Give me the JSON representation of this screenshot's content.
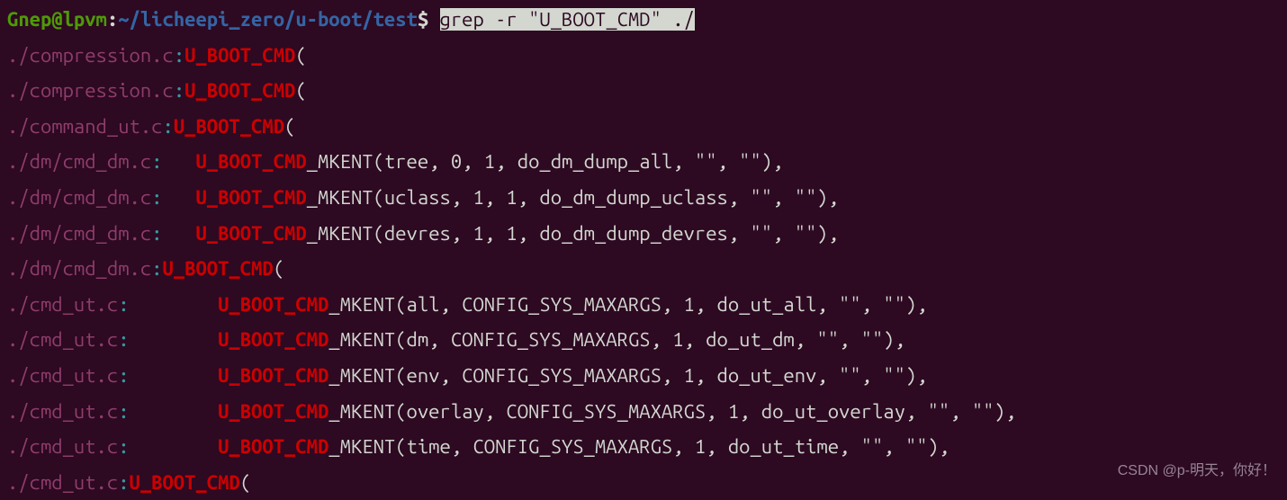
{
  "prompt": {
    "user_host": "Gnep@lpvm",
    "colon": ":",
    "path": "~/licheepi_zero/u-boot/test",
    "dollar": "$ ",
    "command": "grep -r \"U_BOOT_CMD\" ./"
  },
  "lines": [
    {
      "file": "./compression.c",
      "sep": ":",
      "pad": "",
      "match": "U_BOOT_CMD",
      "rest": "("
    },
    {
      "file": "./compression.c",
      "sep": ":",
      "pad": "",
      "match": "U_BOOT_CMD",
      "rest": "("
    },
    {
      "file": "./command_ut.c",
      "sep": ":",
      "pad": "",
      "match": "U_BOOT_CMD",
      "rest": "("
    },
    {
      "file": "./dm/cmd_dm.c",
      "sep": ":",
      "pad": "   ",
      "match": "U_BOOT_CMD",
      "rest": "_MKENT(tree, 0, 1, do_dm_dump_all, \"\", \"\"),"
    },
    {
      "file": "./dm/cmd_dm.c",
      "sep": ":",
      "pad": "   ",
      "match": "U_BOOT_CMD",
      "rest": "_MKENT(uclass, 1, 1, do_dm_dump_uclass, \"\", \"\"),"
    },
    {
      "file": "./dm/cmd_dm.c",
      "sep": ":",
      "pad": "   ",
      "match": "U_BOOT_CMD",
      "rest": "_MKENT(devres, 1, 1, do_dm_dump_devres, \"\", \"\"),"
    },
    {
      "file": "./dm/cmd_dm.c",
      "sep": ":",
      "pad": "",
      "match": "U_BOOT_CMD",
      "rest": "("
    },
    {
      "file": "./cmd_ut.c",
      "sep": ":",
      "pad": "        ",
      "match": "U_BOOT_CMD",
      "rest": "_MKENT(all, CONFIG_SYS_MAXARGS, 1, do_ut_all, \"\", \"\"),"
    },
    {
      "file": "./cmd_ut.c",
      "sep": ":",
      "pad": "        ",
      "match": "U_BOOT_CMD",
      "rest": "_MKENT(dm, CONFIG_SYS_MAXARGS, 1, do_ut_dm, \"\", \"\"),"
    },
    {
      "file": "./cmd_ut.c",
      "sep": ":",
      "pad": "        ",
      "match": "U_BOOT_CMD",
      "rest": "_MKENT(env, CONFIG_SYS_MAXARGS, 1, do_ut_env, \"\", \"\"),"
    },
    {
      "file": "./cmd_ut.c",
      "sep": ":",
      "pad": "        ",
      "match": "U_BOOT_CMD",
      "rest": "_MKENT(overlay, CONFIG_SYS_MAXARGS, 1, do_ut_overlay, \"\", \"\"),"
    },
    {
      "file": "./cmd_ut.c",
      "sep": ":",
      "pad": "        ",
      "match": "U_BOOT_CMD",
      "rest": "_MKENT(time, CONFIG_SYS_MAXARGS, 1, do_ut_time, \"\", \"\"),"
    },
    {
      "file": "./cmd_ut.c",
      "sep": ":",
      "pad": "",
      "match": "U_BOOT_CMD",
      "rest": "("
    }
  ],
  "watermark": "CSDN @p-明天，你好！"
}
